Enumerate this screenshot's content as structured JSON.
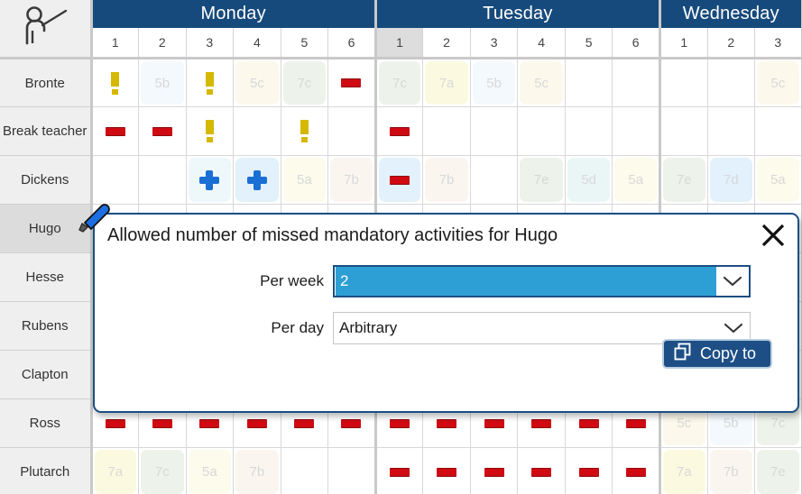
{
  "app": {
    "corner_icon": "teacher-pointer-icon"
  },
  "timetable": {
    "days": [
      {
        "label": "Monday",
        "slots": [
          "1",
          "2",
          "3",
          "4",
          "5",
          "6"
        ],
        "selected_slot": null
      },
      {
        "label": "Tuesday",
        "slots": [
          "1",
          "2",
          "3",
          "4",
          "5",
          "6"
        ],
        "selected_slot": "1"
      },
      {
        "label": "Wednesday",
        "slots": [
          "1",
          "2",
          "3"
        ],
        "selected_slot": null
      }
    ],
    "rows": [
      {
        "name": "Bronte",
        "selected": false
      },
      {
        "name": "Break teacher",
        "selected": false
      },
      {
        "name": "Dickens",
        "selected": false
      },
      {
        "name": "Hugo",
        "selected": true
      },
      {
        "name": "Hesse",
        "selected": false
      },
      {
        "name": "Rubens",
        "selected": false
      },
      {
        "name": "Clapton",
        "selected": false
      },
      {
        "name": "Ross",
        "selected": false
      },
      {
        "name": "Plutarch",
        "selected": false
      }
    ],
    "cells": [
      [
        {
          "icon": "warning-icon"
        },
        {
          "text": "5b",
          "color": "#f3f9fd"
        },
        {
          "icon": "warning-icon"
        },
        {
          "text": "5c",
          "color": "#fcf8ec"
        },
        {
          "text": "7c",
          "color": "#edf3ea"
        },
        {
          "icon": "dash-icon"
        },
        {
          "text": "7c",
          "color": "#edf3ea"
        },
        {
          "text": "7a",
          "color": "#fbfae0"
        },
        {
          "text": "5b",
          "color": "#f3f9fd"
        },
        {
          "text": "5c",
          "color": "#fcf8ec"
        },
        {},
        {},
        {},
        {},
        {
          "text": "5c",
          "color": "#fcf8ec"
        }
      ],
      [
        {
          "icon": "dash-icon"
        },
        {
          "icon": "dash-icon"
        },
        {
          "icon": "warning-icon"
        },
        {},
        {
          "icon": "warning-icon"
        },
        {},
        {
          "icon": "dash-icon"
        },
        {},
        {},
        {},
        {},
        {},
        {},
        {},
        {}
      ],
      [
        {},
        {},
        {
          "icon": "plus-icon",
          "color": "#eef7fa"
        },
        {
          "icon": "plus-icon",
          "color": "#e2f1fb"
        },
        {
          "text": "5a",
          "color": "#fcfbec"
        },
        {
          "text": "7b",
          "color": "#faf6ef"
        },
        {
          "icon": "dash-icon",
          "color": "#e2f1fb"
        },
        {
          "text": "7b",
          "color": "#faf6ef"
        },
        {},
        {
          "text": "7e",
          "color": "#edf3ea"
        },
        {
          "text": "5d",
          "color": "#eaf6f6"
        },
        {
          "text": "5a",
          "color": "#fcfbec"
        },
        {
          "text": "7e",
          "color": "#edf3ea"
        },
        {
          "text": "7d",
          "color": "#e2f1fb"
        },
        {
          "text": "5a",
          "color": "#fcfbec"
        }
      ],
      [
        {},
        {},
        {},
        {},
        {},
        {},
        {},
        {},
        {},
        {},
        {},
        {},
        {},
        {},
        {}
      ],
      [
        {},
        {},
        {},
        {},
        {},
        {},
        {},
        {},
        {},
        {},
        {},
        {},
        {},
        {},
        {}
      ],
      [
        {},
        {},
        {},
        {},
        {},
        {},
        {},
        {},
        {},
        {},
        {},
        {},
        {},
        {},
        {}
      ],
      [
        {},
        {},
        {},
        {},
        {},
        {},
        {},
        {},
        {},
        {},
        {},
        {},
        {},
        {},
        {}
      ],
      [
        {
          "icon": "dash-icon"
        },
        {
          "icon": "dash-icon"
        },
        {
          "icon": "dash-icon"
        },
        {
          "icon": "dash-icon"
        },
        {
          "icon": "dash-icon"
        },
        {
          "icon": "dash-icon"
        },
        {
          "icon": "dash-icon"
        },
        {
          "icon": "dash-icon"
        },
        {
          "icon": "dash-icon"
        },
        {
          "icon": "dash-icon"
        },
        {
          "icon": "dash-icon"
        },
        {
          "icon": "dash-icon"
        },
        {
          "text": "5c",
          "color": "#fcf8ec"
        },
        {
          "text": "5b",
          "color": "#f3f9fd"
        },
        {
          "text": "7c",
          "color": "#edf3ea"
        }
      ],
      [
        {
          "text": "7a",
          "color": "#fbfae0"
        },
        {
          "text": "7c",
          "color": "#edf3ea"
        },
        {
          "text": "5a",
          "color": "#fcfbec"
        },
        {
          "text": "7b",
          "color": "#faf6ef"
        },
        {},
        {},
        {
          "icon": "dash-icon"
        },
        {
          "icon": "dash-icon"
        },
        {
          "icon": "dash-icon"
        },
        {
          "icon": "dash-icon"
        },
        {
          "icon": "dash-icon"
        },
        {
          "icon": "dash-icon"
        },
        {
          "text": "7a",
          "color": "#fbfae0"
        },
        {
          "text": "7b",
          "color": "#faf6ef"
        },
        {
          "text": "7e",
          "color": "#edf3ea"
        }
      ]
    ]
  },
  "dialog": {
    "title": "Allowed number of missed mandatory activities for Hugo",
    "close_label": "✕",
    "fields": [
      {
        "label": "Per week",
        "value": "2",
        "focused": true
      },
      {
        "label": "Per day",
        "value": "Arbitrary",
        "focused": false
      }
    ],
    "copy_button": {
      "label": "Copy to",
      "icon": "copy-icon"
    }
  },
  "colors": {
    "header_blue": "#174a7c",
    "dialog_border": "#1c4e84",
    "selection_blue": "#2e9fd4",
    "button_blue": "#1d4f86",
    "warning_yellow": "#d5b800",
    "dash_red": "#cf0a12",
    "plus_blue": "#1a6fd4"
  },
  "cursor": {
    "icon": "highlighter-pen-cursor"
  }
}
